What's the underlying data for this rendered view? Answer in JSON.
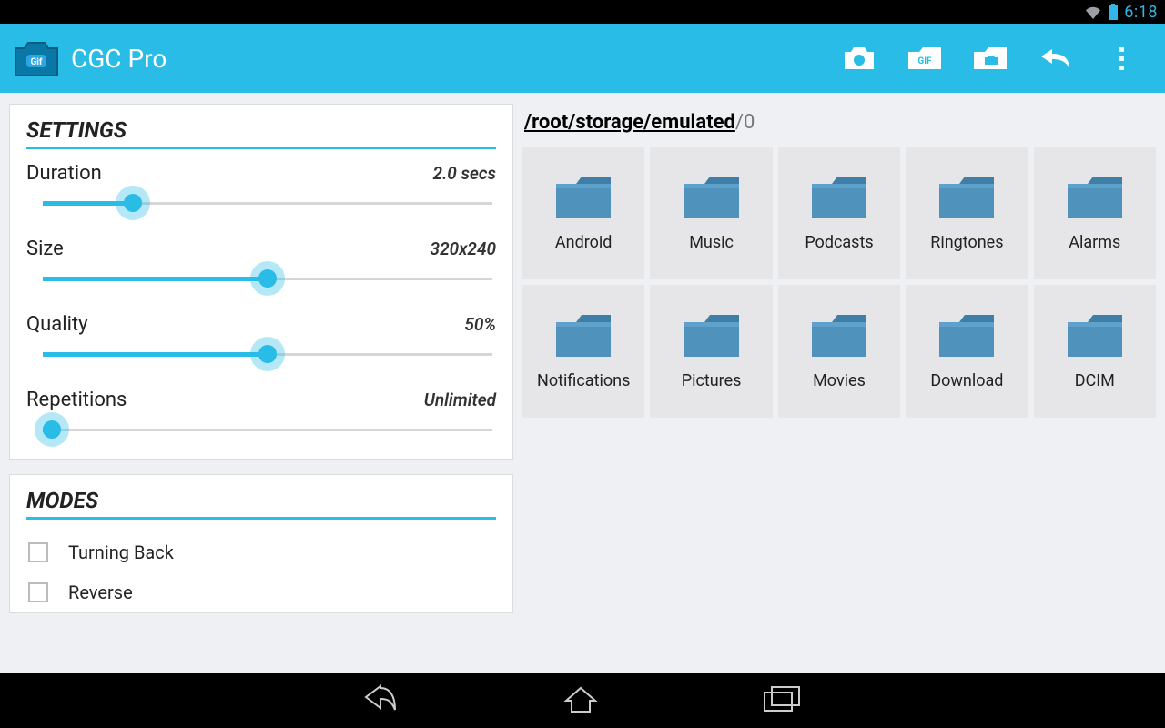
{
  "status_bar": {
    "time": "6:18"
  },
  "action_bar": {
    "title": "CGC Pro"
  },
  "settings_panel": {
    "title": "SETTINGS",
    "sliders": [
      {
        "label": "Duration",
        "value": "2.0 secs",
        "fill_percent": 20
      },
      {
        "label": "Size",
        "value": "320x240",
        "fill_percent": 50
      },
      {
        "label": "Quality",
        "value": "50%",
        "fill_percent": 50
      },
      {
        "label": "Repetitions",
        "value": "Unlimited",
        "fill_percent": 2
      }
    ]
  },
  "modes_panel": {
    "title": "MODES",
    "items": [
      {
        "label": "Turning Back",
        "checked": false
      },
      {
        "label": "Reverse",
        "checked": false
      }
    ]
  },
  "browser": {
    "path_linked": "/root/storage/emulated",
    "path_tail": "/0",
    "folders": [
      "Android",
      "Music",
      "Podcasts",
      "Ringtones",
      "Alarms",
      "Notifications",
      "Pictures",
      "Movies",
      "Download",
      "DCIM"
    ]
  }
}
